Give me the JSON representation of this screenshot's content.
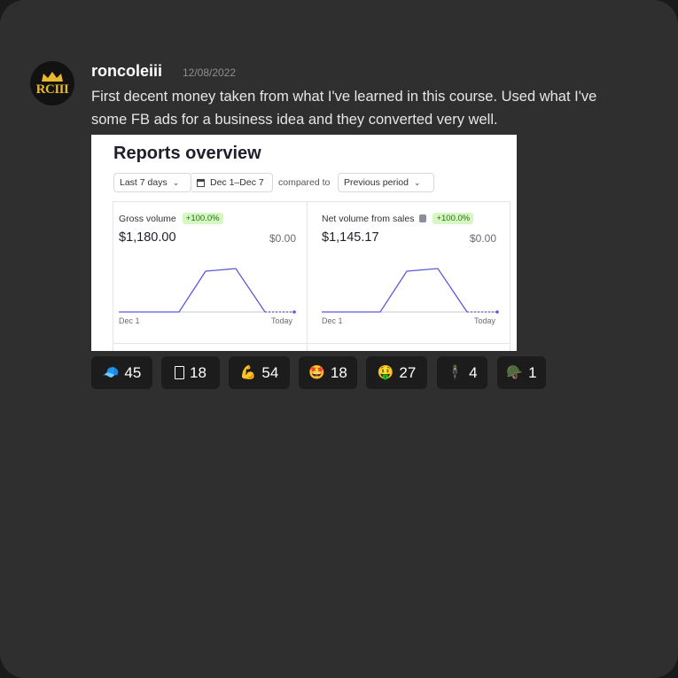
{
  "post": {
    "username": "roncoleiii",
    "timestamp": "12/08/2022",
    "avatar_text": "RCIII",
    "message_lines": [
      "First decent money taken from what I've learned in this course. Used what I've",
      "some FB ads for a business idea and they converted very well."
    ]
  },
  "screenshot": {
    "title": "Reports overview",
    "filters": {
      "range_label": "Last 7 days",
      "date_label": "Dec 1–Dec 7",
      "compared_text": "compared to",
      "comparison_label": "Previous period"
    },
    "metrics": [
      {
        "label": "Gross volume",
        "badge": "+100.0%",
        "value": "$1,180.00",
        "previous": "$0.00",
        "axis_start": "Dec 1",
        "axis_end": "Today",
        "has_info_icon": false
      },
      {
        "label": "Net volume from sales",
        "badge": "+100.0%",
        "value": "$1,145.17",
        "previous": "$0.00",
        "axis_start": "Dec 1",
        "axis_end": "Today",
        "has_info_icon": true
      }
    ],
    "line_color": "#5b5bd6"
  },
  "reactions": [
    {
      "icon": "blue-cap-icon",
      "emoji": "🧢",
      "count": "45"
    },
    {
      "icon": "blank-square-icon",
      "emoji": "⬜",
      "count": "18"
    },
    {
      "icon": "flexed-biceps-icon",
      "emoji": "💪",
      "count": "54"
    },
    {
      "icon": "star-struck-icon",
      "emoji": "🤩",
      "count": "18"
    },
    {
      "icon": "money-mouth-face-icon",
      "emoji": "🤑",
      "count": "27"
    },
    {
      "icon": "figure-icon",
      "emoji": "🕴",
      "count": "4"
    },
    {
      "icon": "military-helmet-icon",
      "emoji": "🪖",
      "count": "1"
    }
  ]
}
